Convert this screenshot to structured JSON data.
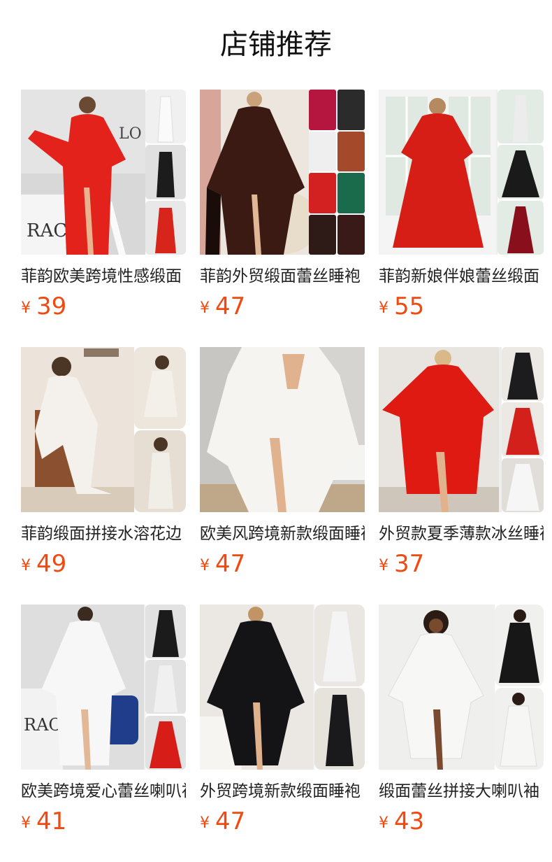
{
  "section": {
    "title": "店铺推荐"
  },
  "currency_symbol": "¥",
  "products": [
    {
      "name": "菲韵欧美跨境性感缎面",
      "price": "39",
      "robe_color": "#e3231b",
      "bg_color": "#d9d9d9",
      "side_colors": [
        "#f2f2f2",
        "#1c1c1c",
        "#d8251c"
      ]
    },
    {
      "name": "菲韵外贸缎面蕾丝睡袍",
      "price": "47",
      "robe_color": "#3a1a12",
      "bg_color": "#e8e2dc",
      "side_colors": [
        "#b5163f",
        "#2b2b2b",
        "#f0efef",
        "#a44a2a",
        "#d32020",
        "#1a6a4c",
        "#2e1a16",
        "#3a1a18"
      ]
    },
    {
      "name": "菲韵新娘伴娘蕾丝缎面",
      "price": "55",
      "robe_color": "#d71e16",
      "bg_color": "#eef1f0",
      "side_colors": [
        "#ececec",
        "#1a1a1a",
        "#8a0f1c"
      ]
    },
    {
      "name": "菲韵缎面拼接水溶花边",
      "price": "49",
      "robe_color": "#f4f1ec",
      "bg_color": "#e8dfd6",
      "side_colors": [
        "#f3efe9",
        "#f1ede7"
      ]
    },
    {
      "name": "欧美风跨境新款缎面睡袍",
      "price": "47",
      "robe_color": "#f6f4f0",
      "bg_color": "#d8d6d2",
      "side_colors": []
    },
    {
      "name": "外贸款夏季薄款冰丝睡袍",
      "price": "37",
      "robe_color": "#de1a12",
      "bg_color": "#e7e3de",
      "side_colors": [
        "#1c1c1e",
        "#d3201a",
        "#efefef"
      ]
    },
    {
      "name": "欧美跨境爱心蕾丝喇叭袖",
      "price": "41",
      "robe_color": "#f7f7f7",
      "bg_color": "#dcdcdc",
      "side_colors": [
        "#1b1b1b",
        "#f0f0f0",
        "#d71d18"
      ]
    },
    {
      "name": "外贸跨境新款缎面睡袍",
      "price": "47",
      "robe_color": "#141416",
      "bg_color": "#eceae6",
      "side_colors": [
        "#f4f4f4",
        "#1a1a1c"
      ]
    },
    {
      "name": "缎面蕾丝拼接大喇叭袖",
      "price": "43",
      "robe_color": "#f7f7f5",
      "bg_color": "#ececea",
      "side_colors": [
        "#171717",
        "#f6f6f4"
      ]
    }
  ]
}
